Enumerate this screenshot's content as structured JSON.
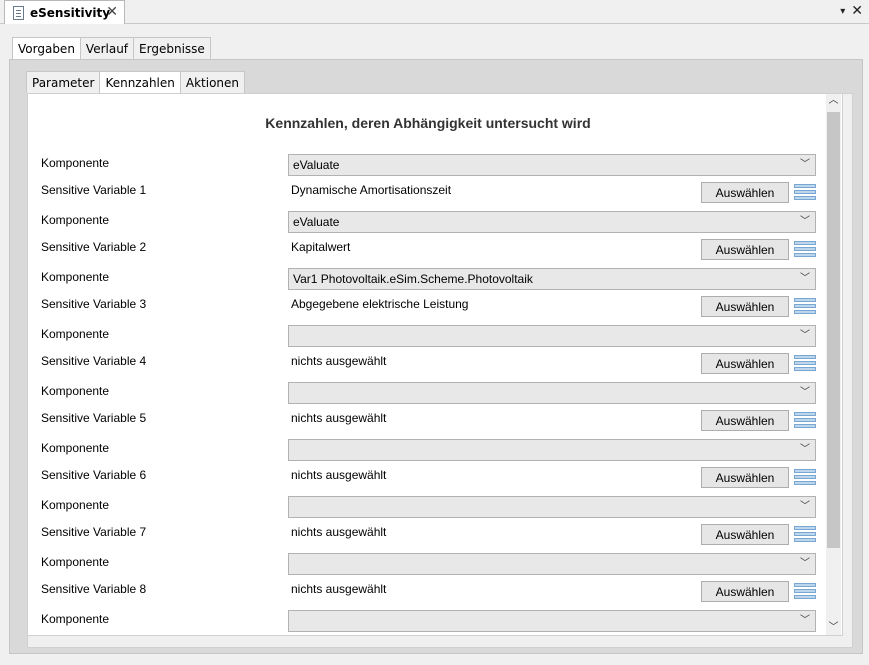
{
  "window": {
    "tab_title": "eSensitivity",
    "close_glyph": "✕",
    "menu_glyph": "▾",
    "window_close_glyph": "✕"
  },
  "outer_tabs": [
    {
      "label": "Vorgaben",
      "active": true
    },
    {
      "label": "Verlauf",
      "active": false
    },
    {
      "label": "Ergebnisse",
      "active": false
    }
  ],
  "inner_tabs": [
    {
      "label": "Parameter",
      "active": false
    },
    {
      "label": "Kennzahlen",
      "active": true
    },
    {
      "label": "Aktionen",
      "active": false
    }
  ],
  "heading": "Kennzahlen, deren Abhängigkeit untersucht wird",
  "komponente_label": "Komponente",
  "button_label": "Auswählen",
  "rows": [
    {
      "komponente": "eValuate",
      "var_label": "Sensitive Variable 1",
      "value": "Dynamische Amortisationszeit"
    },
    {
      "komponente": "eValuate",
      "var_label": "Sensitive Variable 2",
      "value": "Kapitalwert"
    },
    {
      "komponente": "Var1 Photovoltaik.eSim.Scheme.Photovoltaik",
      "var_label": "Sensitive Variable 3",
      "value": "Abgegebene elektrische Leistung"
    },
    {
      "komponente": "",
      "var_label": "Sensitive Variable 4",
      "value": "nichts ausgewählt"
    },
    {
      "komponente": "",
      "var_label": "Sensitive Variable 5",
      "value": "nichts ausgewählt"
    },
    {
      "komponente": "",
      "var_label": "Sensitive Variable 6",
      "value": "nichts ausgewählt"
    },
    {
      "komponente": "",
      "var_label": "Sensitive Variable 7",
      "value": "nichts ausgewählt"
    },
    {
      "komponente": "",
      "var_label": "Sensitive Variable 8",
      "value": "nichts ausgewählt"
    },
    {
      "komponente": "",
      "var_label": "",
      "value": ""
    }
  ],
  "icons": {
    "document": "document-icon",
    "list": "list-icon",
    "dropdown": "chevron-down-icon",
    "scroll_up": "scroll-up-icon",
    "scroll_down": "scroll-down-icon"
  }
}
